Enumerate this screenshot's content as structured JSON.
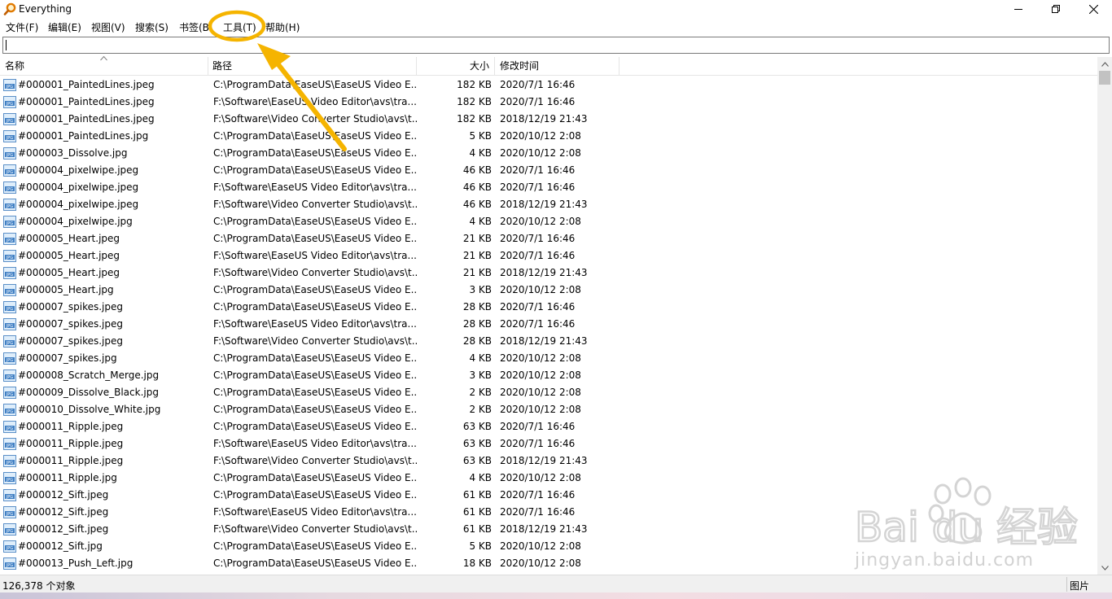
{
  "window": {
    "title": "Everything",
    "accent": "#f5a800"
  },
  "menu": [
    {
      "label": "文件(F)"
    },
    {
      "label": "编辑(E)"
    },
    {
      "label": "视图(V)"
    },
    {
      "label": "搜索(S)"
    },
    {
      "label": "书签(B)"
    },
    {
      "label": "工具(T)"
    },
    {
      "label": "帮助(H)"
    }
  ],
  "search": {
    "value": "",
    "placeholder": ""
  },
  "columns": {
    "name": "名称",
    "path": "路径",
    "size": "大小",
    "date": "修改时间"
  },
  "rows": [
    {
      "name": "#000001_PaintedLines.jpeg",
      "path": "C:\\ProgramData\\EaseUS\\EaseUS Video E...",
      "size": "182 KB",
      "date": "2020/7/1 16:46"
    },
    {
      "name": "#000001_PaintedLines.jpeg",
      "path": "F:\\Software\\EaseUS Video Editor\\avs\\tra...",
      "size": "182 KB",
      "date": "2020/7/1 16:46"
    },
    {
      "name": "#000001_PaintedLines.jpeg",
      "path": "F:\\Software\\Video Converter Studio\\avs\\t...",
      "size": "182 KB",
      "date": "2018/12/19 21:43"
    },
    {
      "name": "#000001_PaintedLines.jpg",
      "path": "C:\\ProgramData\\EaseUS\\EaseUS Video E...",
      "size": "5 KB",
      "date": "2020/10/12 2:08"
    },
    {
      "name": "#000003_Dissolve.jpg",
      "path": "C:\\ProgramData\\EaseUS\\EaseUS Video E...",
      "size": "4 KB",
      "date": "2020/10/12 2:08"
    },
    {
      "name": "#000004_pixelwipe.jpeg",
      "path": "C:\\ProgramData\\EaseUS\\EaseUS Video E...",
      "size": "46 KB",
      "date": "2020/7/1 16:46"
    },
    {
      "name": "#000004_pixelwipe.jpeg",
      "path": "F:\\Software\\EaseUS Video Editor\\avs\\tra...",
      "size": "46 KB",
      "date": "2020/7/1 16:46"
    },
    {
      "name": "#000004_pixelwipe.jpeg",
      "path": "F:\\Software\\Video Converter Studio\\avs\\t...",
      "size": "46 KB",
      "date": "2018/12/19 21:43"
    },
    {
      "name": "#000004_pixelwipe.jpg",
      "path": "C:\\ProgramData\\EaseUS\\EaseUS Video E...",
      "size": "4 KB",
      "date": "2020/10/12 2:08"
    },
    {
      "name": "#000005_Heart.jpeg",
      "path": "C:\\ProgramData\\EaseUS\\EaseUS Video E...",
      "size": "21 KB",
      "date": "2020/7/1 16:46"
    },
    {
      "name": "#000005_Heart.jpeg",
      "path": "F:\\Software\\EaseUS Video Editor\\avs\\tra...",
      "size": "21 KB",
      "date": "2020/7/1 16:46"
    },
    {
      "name": "#000005_Heart.jpeg",
      "path": "F:\\Software\\Video Converter Studio\\avs\\t...",
      "size": "21 KB",
      "date": "2018/12/19 21:43"
    },
    {
      "name": "#000005_Heart.jpg",
      "path": "C:\\ProgramData\\EaseUS\\EaseUS Video E...",
      "size": "3 KB",
      "date": "2020/10/12 2:08"
    },
    {
      "name": "#000007_spikes.jpeg",
      "path": "C:\\ProgramData\\EaseUS\\EaseUS Video E...",
      "size": "28 KB",
      "date": "2020/7/1 16:46"
    },
    {
      "name": "#000007_spikes.jpeg",
      "path": "F:\\Software\\EaseUS Video Editor\\avs\\tra...",
      "size": "28 KB",
      "date": "2020/7/1 16:46"
    },
    {
      "name": "#000007_spikes.jpeg",
      "path": "F:\\Software\\Video Converter Studio\\avs\\t...",
      "size": "28 KB",
      "date": "2018/12/19 21:43"
    },
    {
      "name": "#000007_spikes.jpg",
      "path": "C:\\ProgramData\\EaseUS\\EaseUS Video E...",
      "size": "4 KB",
      "date": "2020/10/12 2:08"
    },
    {
      "name": "#000008_Scratch_Merge.jpg",
      "path": "C:\\ProgramData\\EaseUS\\EaseUS Video E...",
      "size": "3 KB",
      "date": "2020/10/12 2:08"
    },
    {
      "name": "#000009_Dissolve_Black.jpg",
      "path": "C:\\ProgramData\\EaseUS\\EaseUS Video E...",
      "size": "2 KB",
      "date": "2020/10/12 2:08"
    },
    {
      "name": "#000010_Dissolve_White.jpg",
      "path": "C:\\ProgramData\\EaseUS\\EaseUS Video E...",
      "size": "2 KB",
      "date": "2020/10/12 2:08"
    },
    {
      "name": "#000011_Ripple.jpeg",
      "path": "C:\\ProgramData\\EaseUS\\EaseUS Video E...",
      "size": "63 KB",
      "date": "2020/7/1 16:46"
    },
    {
      "name": "#000011_Ripple.jpeg",
      "path": "F:\\Software\\EaseUS Video Editor\\avs\\tra...",
      "size": "63 KB",
      "date": "2020/7/1 16:46"
    },
    {
      "name": "#000011_Ripple.jpeg",
      "path": "F:\\Software\\Video Converter Studio\\avs\\t...",
      "size": "63 KB",
      "date": "2018/12/19 21:43"
    },
    {
      "name": "#000011_Ripple.jpg",
      "path": "C:\\ProgramData\\EaseUS\\EaseUS Video E...",
      "size": "4 KB",
      "date": "2020/10/12 2:08"
    },
    {
      "name": "#000012_Sift.jpeg",
      "path": "C:\\ProgramData\\EaseUS\\EaseUS Video E...",
      "size": "61 KB",
      "date": "2020/7/1 16:46"
    },
    {
      "name": "#000012_Sift.jpeg",
      "path": "F:\\Software\\EaseUS Video Editor\\avs\\tra...",
      "size": "61 KB",
      "date": "2020/7/1 16:46"
    },
    {
      "name": "#000012_Sift.jpeg",
      "path": "F:\\Software\\Video Converter Studio\\avs\\t...",
      "size": "61 KB",
      "date": "2018/12/19 21:43"
    },
    {
      "name": "#000012_Sift.jpg",
      "path": "C:\\ProgramData\\EaseUS\\EaseUS Video E...",
      "size": "5 KB",
      "date": "2020/10/12 2:08"
    },
    {
      "name": "#000013_Push_Left.jpg",
      "path": "C:\\ProgramData\\EaseUS\\EaseUS Video E...",
      "size": "18 KB",
      "date": "2020/10/12 2:08"
    }
  ],
  "status": {
    "count": "126,378 个对象",
    "filter": "图片"
  },
  "watermark": {
    "text": "jingyan.baidu.com",
    "brand": "Bai du 经验"
  },
  "icons": {
    "file": "jpg-file-icon",
    "app": "everything-search-icon"
  }
}
